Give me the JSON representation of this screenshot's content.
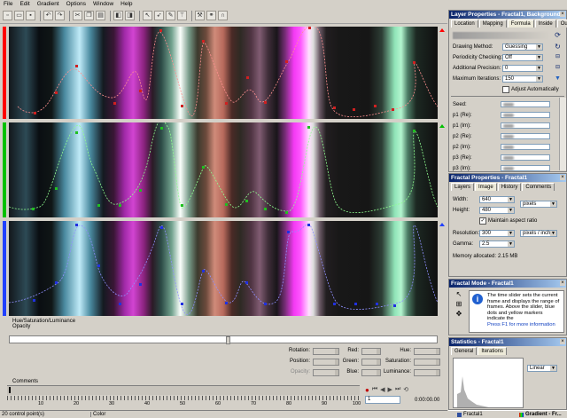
{
  "menu": [
    "File",
    "Edit",
    "Gradient",
    "Options",
    "Window",
    "Help"
  ],
  "gradient_panels": {
    "labels": [
      "Hue/Saturation/Luminance",
      "Opacity"
    ],
    "accent_colors": {
      "red": "#ff0000",
      "green": "#00c000",
      "blue": "#2040ff"
    }
  },
  "controls": {
    "rotation_label": "Rotation:",
    "position_label": "Position:",
    "opacity_label": "Opacity:",
    "red_label": "Red:",
    "green_label": "Green:",
    "blue_label": "Blue:",
    "hue_label": "Hue:",
    "saturation_label": "Saturation:",
    "luminance_label": "Luminance:"
  },
  "timeline": {
    "label": "Comments",
    "ticks": [
      "10",
      "20",
      "30",
      "40",
      "50",
      "60",
      "70",
      "80",
      "90",
      "100"
    ],
    "frame_value": "1",
    "time_value": "0:00:00.00"
  },
  "layer_properties": {
    "title": "Layer Properties - Fractal1, Background",
    "tabs": [
      "Location",
      "Mapping",
      "Formula",
      "Inside",
      "Outside"
    ],
    "active_tab": "Formula",
    "drawing_method_label": "Drawing Method:",
    "drawing_method_value": "Guessing",
    "periodicity_label": "Periodicity Checking:",
    "periodicity_value": "Off",
    "additional_precision_label": "Additional Precision:",
    "additional_precision_value": "0",
    "max_iterations_label": "Maximum Iterations:",
    "max_iterations_value": "150",
    "adjust_auto_label": "Adjust Automatically",
    "seed_label": "Seed:",
    "params": [
      "p1 (Re):",
      "p1 (Im):",
      "p2 (Re):",
      "p2 (Im):",
      "p3 (Re):",
      "p3 (Im):"
    ]
  },
  "fractal_properties": {
    "title": "Fractal Properties - Fractal1",
    "tabs": [
      "Layers",
      "Image",
      "History",
      "Comments"
    ],
    "active_tab": "Image",
    "width_label": "Width:",
    "width_value": "640",
    "height_label": "Height:",
    "height_value": "480",
    "size_unit": "pixels",
    "maintain_aspect_label": "Maintain aspect ratio",
    "resolution_label": "Resolution:",
    "resolution_value": "300",
    "resolution_unit": "pixels / inch",
    "gamma_label": "Gamma:",
    "gamma_value": "2.5",
    "memory_label": "Memory allocated:",
    "memory_value": "2.15 MB"
  },
  "fractal_mode": {
    "title": "Fractal Mode - Fractal1",
    "info_text": "The time slider sets the current frame and displays the range of frames. Above the slider, blue dots and yellow markers indicate the",
    "help_link": "Press F1 for more information"
  },
  "statistics": {
    "title": "Statistics - Fractal1",
    "tabs": [
      "General",
      "Iterations"
    ],
    "active_tab": "Iterations",
    "scale_value": "Linear"
  },
  "statusbar": {
    "control_points": "20 control point(s)",
    "color_label": "Color"
  },
  "taskbar": {
    "items": [
      "Fractal1",
      "Gradient - Fr..."
    ]
  }
}
